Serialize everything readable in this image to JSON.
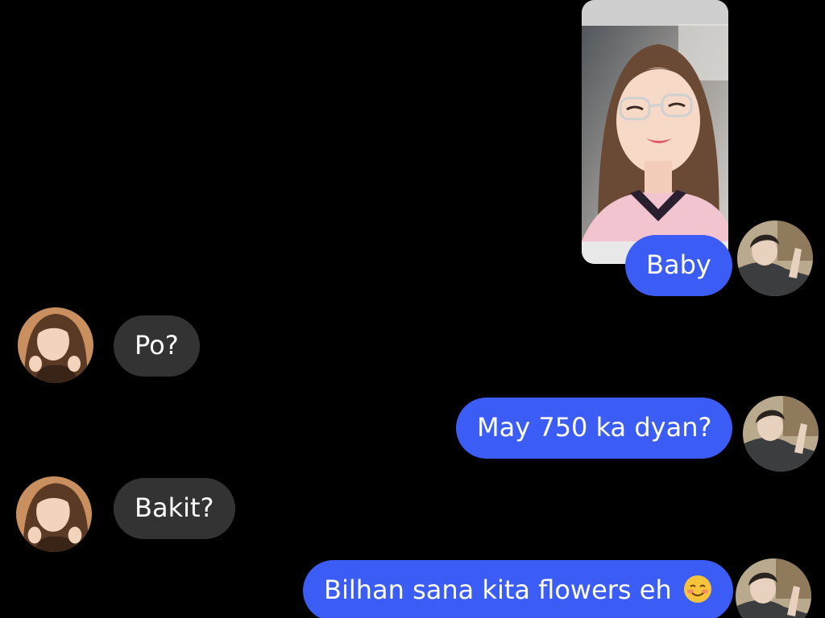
{
  "messages": [
    {
      "side": "out",
      "text": "Baby"
    },
    {
      "side": "in",
      "text": "Po?"
    },
    {
      "side": "out",
      "text": "May 750 ka dyan?"
    },
    {
      "side": "in",
      "text": "Bakit?"
    },
    {
      "side": "out",
      "text": "Bilhan sana kita flowers eh"
    }
  ],
  "attachment": {
    "type": "photo",
    "subject": "selfie-photo"
  },
  "icons": {
    "emoji": "smiling-face-with-blush-icon"
  },
  "colors": {
    "background": "#000000",
    "outgoing_bubble": "#3b5cf5",
    "incoming_bubble": "#333333",
    "text": "#ffffff"
  }
}
